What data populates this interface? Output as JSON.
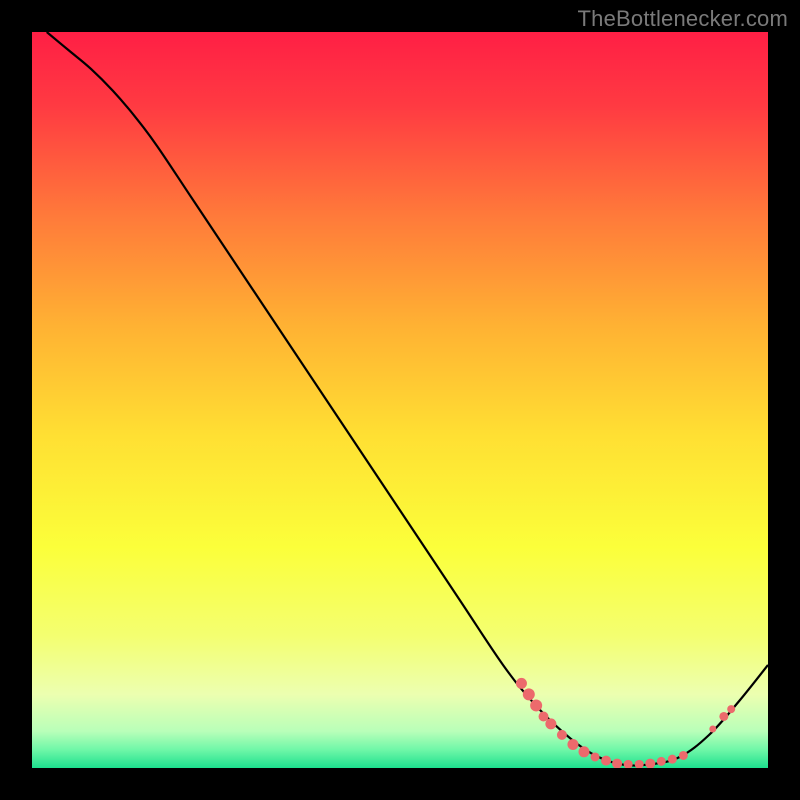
{
  "watermark": "TheBottlenecker.com",
  "chart_data": {
    "type": "line",
    "title": "",
    "xlabel": "",
    "ylabel": "",
    "xlim": [
      0,
      100
    ],
    "ylim": [
      0,
      100
    ],
    "background": {
      "gradient_stops": [
        {
          "offset": 0.0,
          "color": "#ff1f45"
        },
        {
          "offset": 0.1,
          "color": "#ff3a42"
        },
        {
          "offset": 0.25,
          "color": "#ff7a3a"
        },
        {
          "offset": 0.4,
          "color": "#ffb233"
        },
        {
          "offset": 0.55,
          "color": "#ffe033"
        },
        {
          "offset": 0.7,
          "color": "#fbff3a"
        },
        {
          "offset": 0.82,
          "color": "#f4ff70"
        },
        {
          "offset": 0.9,
          "color": "#ecffb0"
        },
        {
          "offset": 0.95,
          "color": "#b9ffb9"
        },
        {
          "offset": 0.975,
          "color": "#70f7a8"
        },
        {
          "offset": 1.0,
          "color": "#1de08e"
        }
      ]
    },
    "series": [
      {
        "name": "curve",
        "color": "#000000",
        "points": [
          {
            "x": 2.0,
            "y": 100.0
          },
          {
            "x": 5.0,
            "y": 97.5
          },
          {
            "x": 8.0,
            "y": 95.0
          },
          {
            "x": 11.0,
            "y": 92.0
          },
          {
            "x": 14.0,
            "y": 88.5
          },
          {
            "x": 17.0,
            "y": 84.5
          },
          {
            "x": 22.0,
            "y": 77.0
          },
          {
            "x": 30.0,
            "y": 65.0
          },
          {
            "x": 40.0,
            "y": 50.0
          },
          {
            "x": 50.0,
            "y": 35.0
          },
          {
            "x": 58.0,
            "y": 23.0
          },
          {
            "x": 64.0,
            "y": 14.0
          },
          {
            "x": 68.0,
            "y": 9.0
          },
          {
            "x": 72.0,
            "y": 5.0
          },
          {
            "x": 76.0,
            "y": 2.0
          },
          {
            "x": 80.0,
            "y": 0.5
          },
          {
            "x": 84.0,
            "y": 0.5
          },
          {
            "x": 88.0,
            "y": 1.5
          },
          {
            "x": 92.0,
            "y": 4.5
          },
          {
            "x": 96.0,
            "y": 9.0
          },
          {
            "x": 100.0,
            "y": 14.0
          }
        ]
      }
    ],
    "markers": [
      {
        "x": 66.5,
        "y": 11.5,
        "r": 5.5
      },
      {
        "x": 67.5,
        "y": 10.0,
        "r": 6.0
      },
      {
        "x": 68.5,
        "y": 8.5,
        "r": 6.0
      },
      {
        "x": 69.5,
        "y": 7.0,
        "r": 5.0
      },
      {
        "x": 70.5,
        "y": 6.0,
        "r": 5.5
      },
      {
        "x": 72.0,
        "y": 4.5,
        "r": 5.0
      },
      {
        "x": 73.5,
        "y": 3.2,
        "r": 5.5
      },
      {
        "x": 75.0,
        "y": 2.2,
        "r": 5.5
      },
      {
        "x": 76.5,
        "y": 1.5,
        "r": 4.5
      },
      {
        "x": 78.0,
        "y": 1.0,
        "r": 5.0
      },
      {
        "x": 79.5,
        "y": 0.6,
        "r": 5.0
      },
      {
        "x": 81.0,
        "y": 0.5,
        "r": 4.5
      },
      {
        "x": 82.5,
        "y": 0.5,
        "r": 4.5
      },
      {
        "x": 84.0,
        "y": 0.6,
        "r": 5.0
      },
      {
        "x": 85.5,
        "y": 0.9,
        "r": 4.5
      },
      {
        "x": 87.0,
        "y": 1.2,
        "r": 4.5
      },
      {
        "x": 88.5,
        "y": 1.7,
        "r": 4.5
      },
      {
        "x": 92.5,
        "y": 5.3,
        "r": 3.5
      },
      {
        "x": 94.0,
        "y": 7.0,
        "r": 4.5
      },
      {
        "x": 95.0,
        "y": 8.0,
        "r": 4.0
      }
    ],
    "marker_color": "#ec6a6c"
  }
}
